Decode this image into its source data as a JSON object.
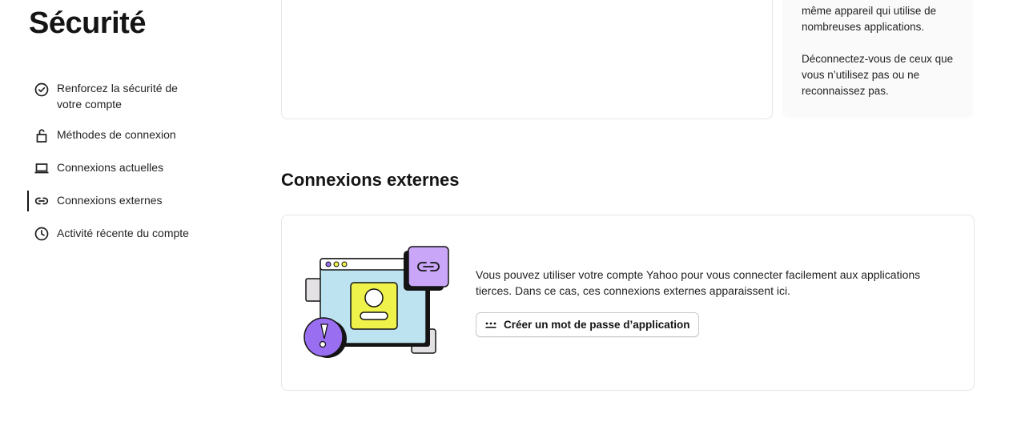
{
  "page": {
    "title": "Sécurité"
  },
  "sidebar": {
    "items": [
      {
        "icon": "check-circle-icon",
        "label": "Renforcez la sécurité de votre compte"
      },
      {
        "icon": "unlock-icon",
        "label": "Méthodes de connexion"
      },
      {
        "icon": "laptop-icon",
        "label": "Connexions actuelles"
      },
      {
        "icon": "link-icon",
        "label": "Connexions externes",
        "active": true
      },
      {
        "icon": "clock-icon",
        "label": "Activité récente du compte"
      }
    ]
  },
  "side_note": {
    "line1": "même appareil qui utilise de nombreuses applications.",
    "line2": "Déconnectez-vous de ceux que vous n’utilisez pas ou ne reconnaissez pas."
  },
  "external": {
    "title": "Connexions externes",
    "description": "Vous pouvez utiliser votre compte Yahoo pour vous connecter facilement aux applications tierces. Dans ce cas, ces connexions externes apparaissent ici.",
    "button_label": "Créer un mot de passe d’application",
    "button_icon": "password-dots-icon"
  },
  "colors": {
    "illustration_window": "#bde3f1",
    "illustration_badge_yellow": "#eef24a",
    "illustration_purple": "#c9a6f7",
    "illustration_alert": "#9a6ef0"
  }
}
